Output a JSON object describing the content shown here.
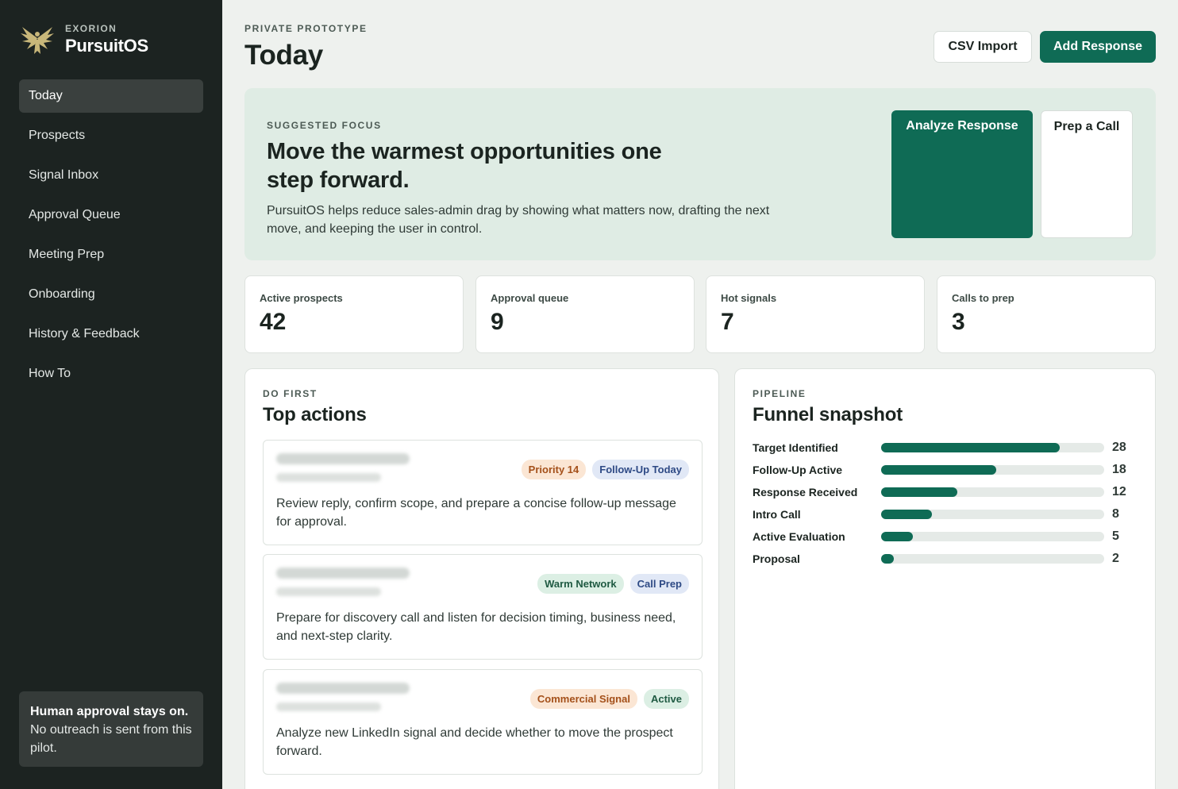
{
  "colors": {
    "sidebar_bg": "#1c2321",
    "accent": "#0f6b55",
    "page_bg": "#eef1ee",
    "focus_bg": "#dfece4"
  },
  "sidebar": {
    "brand": {
      "company": "EXORION",
      "product": "PursuitOS",
      "logo_icon": "phoenix-logo-icon"
    },
    "items": [
      {
        "label": "Today",
        "active": true
      },
      {
        "label": "Prospects"
      },
      {
        "label": "Signal Inbox"
      },
      {
        "label": "Approval Queue"
      },
      {
        "label": "Meeting Prep"
      },
      {
        "label": "Onboarding"
      },
      {
        "label": "History & Feedback"
      },
      {
        "label": "How To"
      }
    ],
    "note": {
      "title": "Human approval stays on.",
      "body": "No outreach is sent from this pilot."
    }
  },
  "header": {
    "eyebrow": "PRIVATE PROTOTYPE",
    "title": "Today",
    "csv_label": "CSV Import",
    "add_label": "Add Response"
  },
  "focus": {
    "eyebrow": "SUGGESTED FOCUS",
    "title": "Move the warmest opportunities one step forward.",
    "description": "PursuitOS helps reduce sales-admin drag by showing what matters now, drafting the next move, and keeping the user in control.",
    "primary_label": "Analyze Response",
    "secondary_label": "Prep a Call"
  },
  "metrics": [
    {
      "label": "Active prospects",
      "value": "42"
    },
    {
      "label": "Approval queue",
      "value": "9"
    },
    {
      "label": "Hot signals",
      "value": "7"
    },
    {
      "label": "Calls to prep",
      "value": "3"
    }
  ],
  "actions": {
    "eyebrow": "DO FIRST",
    "title": "Top actions",
    "items": [
      {
        "tags": [
          {
            "label": "Priority 14",
            "bg": "#fbe6d4",
            "fg": "#a4501a"
          },
          {
            "label": "Follow-Up Today",
            "bg": "#e1e8f6",
            "fg": "#2e4a85"
          }
        ],
        "text": "Review reply, confirm scope, and prepare a concise follow-up message for approval."
      },
      {
        "tags": [
          {
            "label": "Warm Network",
            "bg": "#dcefe4",
            "fg": "#1f5a42"
          },
          {
            "label": "Call Prep",
            "bg": "#e1e8f6",
            "fg": "#2e4a85"
          }
        ],
        "text": "Prepare for discovery call and listen for decision timing, business need, and next-step clarity."
      },
      {
        "tags": [
          {
            "label": "Commercial Signal",
            "bg": "#fbe6d4",
            "fg": "#a4501a"
          },
          {
            "label": "Active",
            "bg": "#dcefe4",
            "fg": "#1f5a42"
          }
        ],
        "text": "Analyze new LinkedIn signal and decide whether to move the prospect forward."
      }
    ]
  },
  "funnel": {
    "eyebrow": "PIPELINE",
    "title": "Funnel snapshot",
    "max": 35,
    "stages": [
      {
        "label": "Target Identified",
        "value": 28
      },
      {
        "label": "Follow-Up Active",
        "value": 18
      },
      {
        "label": "Response Received",
        "value": 12
      },
      {
        "label": "Intro Call",
        "value": 8
      },
      {
        "label": "Active Evaluation",
        "value": 5
      },
      {
        "label": "Proposal",
        "value": 2
      }
    ]
  }
}
